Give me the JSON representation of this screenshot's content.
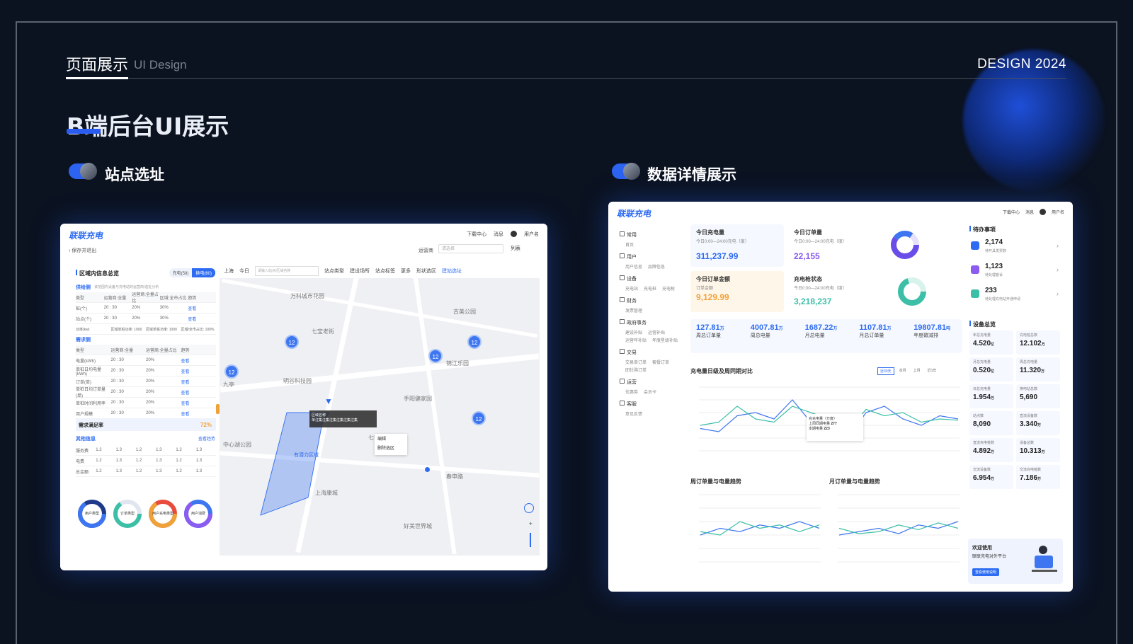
{
  "header": {
    "title": "页面展示",
    "subtitle": "UI Design",
    "right": "DESIGN 2024"
  },
  "page_title": "B端后台UI展示",
  "sections": {
    "left": "站点选址",
    "right": "数据详情展示"
  },
  "screen1": {
    "logo": "联联充电",
    "top_links": [
      "下载中心",
      "消息",
      "用户名"
    ],
    "back": "保存并退出",
    "operator_label": "运营商",
    "operator_placeholder": "请选择",
    "list_btn": "列表",
    "panel_title": "区域内信息总览",
    "tabs": [
      "充电(58)",
      "换电(60)"
    ],
    "supply_title": "供给侧",
    "supply_desc": "该范围内设备与充电站的运营商/选址分析",
    "supply_headers": [
      "类型",
      "运营商:全量",
      "运营商:全量占比",
      "区域:全市占比",
      "趋势"
    ],
    "supply_rows": [
      [
        "桩(个)",
        "20 : 30",
        "20%",
        "30%",
        "查看"
      ],
      [
        "站点(个)",
        "20 : 30",
        "20%",
        "30%",
        "查看"
      ],
      [
        "功率(kw)",
        "区域单桩功率: 1000",
        "区域单桩功率: 1000",
        "区域/全市占比: 100%",
        ""
      ]
    ],
    "demand_title": "需求侧",
    "demand_headers": [
      "类型",
      "运营商:全量",
      "运营商:全量占比",
      "趋势"
    ],
    "demand_rows": [
      [
        "电量(kWh)",
        "20 : 30",
        "20%",
        "查看"
      ],
      [
        "单桩日均电量(kWh)",
        "20 : 30",
        "20%",
        "查看"
      ],
      [
        "订单(单)",
        "20 : 30",
        "20%",
        "查看"
      ],
      [
        "单桩日均订单量(单)",
        "20 : 30",
        "20%",
        "查看"
      ],
      [
        "单桩时间利用率",
        "20 : 30",
        "20%",
        "查看"
      ],
      [
        "用户规模",
        "20 : 30",
        "20%",
        "查看"
      ]
    ],
    "satisfy_label": "需求满足率",
    "satisfy_value": "72%",
    "other_title": "其他信息",
    "other_link": "查看趋势",
    "other_rows": [
      [
        "服务费",
        "1.2",
        "1.3",
        "1.2",
        "1.3",
        "1.2",
        "1.3"
      ],
      [
        "电费",
        "1.2",
        "1.3",
        "1.2",
        "1.3",
        "1.2",
        "1.3"
      ],
      [
        "总金额",
        "1.2",
        "1.3",
        "1.2",
        "1.3",
        "1.2",
        "1.3"
      ]
    ],
    "donut_labels": [
      "用户类型",
      "订单类型",
      "用户充电类型",
      "用户消费"
    ],
    "filters": [
      "上海",
      "今日",
      "请输入站点/区域名称",
      "站点类型",
      "建设场所",
      "站点标签",
      "更多",
      "形状选区",
      "建站选址"
    ],
    "map_labels": [
      "万科城市花园",
      "七宝老街",
      "古美公园",
      "明谷科技园",
      "锦江乐园",
      "手阳健家园",
      "中心湖公园",
      "九亭",
      "七莘立",
      "春申路",
      "上海康城",
      "好美世界城"
    ],
    "cluster_count": "12",
    "popup_title": "区域名称",
    "popup_text": "单注集注集注集注集注集注集",
    "region_label": "有潜力区域",
    "context_menu": [
      "编辑",
      "删除选区"
    ]
  },
  "screen2": {
    "logo": "联联充电",
    "top_links": [
      "下载中心",
      "消息",
      "用户名"
    ],
    "sidebar": [
      {
        "label": "常用",
        "subs": [
          "首页"
        ]
      },
      {
        "label": "用户",
        "subs": [
          "用户信息",
          "品牌信息"
        ]
      },
      {
        "label": "设备",
        "subs": [
          "充电站",
          "充电桩",
          "充电枪"
        ]
      },
      {
        "label": "财务",
        "subs": [
          "发票管理"
        ]
      },
      {
        "label": "政府事务",
        "subs": [
          "建设补贴",
          "运营补贴",
          "运营年补贴",
          "年度星级补贴"
        ]
      },
      {
        "label": "交易",
        "subs": [
          "交易单订单",
          "套餐订单",
          "团社购订单"
        ]
      },
      {
        "label": "运营",
        "subs": [
          "优惠券",
          "会员卡"
        ]
      },
      {
        "label": "客服",
        "subs": [
          "意见反馈"
        ]
      }
    ],
    "kpi_top": [
      {
        "title": "今日充电量",
        "desc": "今日0:00—24:00充电（度）",
        "value": "311,237.99"
      },
      {
        "title": "今日订单量",
        "desc": "今日0:00—24:00充电（度）",
        "value": "22,155"
      },
      {
        "title": "今日订单金额",
        "desc": "订单金额",
        "value": "9,129.99"
      },
      {
        "title": "充电枪状态",
        "desc": "今日0:00—24:00充电（度）",
        "value": "3,218,237"
      }
    ],
    "kpi_row": [
      {
        "value": "127.81",
        "unit": "万",
        "label": "周总订单量"
      },
      {
        "value": "4007.81",
        "unit": "万",
        "label": "周总电量"
      },
      {
        "value": "1687.22",
        "unit": "万",
        "label": "月总电量"
      },
      {
        "value": "1107.81",
        "unit": "万",
        "label": "月总订单量"
      },
      {
        "value": "19807.81",
        "unit": "吨",
        "label": "年度碳减排"
      }
    ],
    "chart_titles": [
      "充电量日级及周同期对比",
      "周订单量与电量趋势",
      "月订单量与电量趋势"
    ],
    "chart_tabs": [
      "近30天",
      "本月",
      "上月",
      "近1年"
    ],
    "tooltip": {
      "title": "充充电量（万度）",
      "a_label": "上周同期电量",
      "a_value": "277",
      "b_label": "本期电量",
      "b_value": "223"
    },
    "todo_title": "待办事项",
    "todos": [
      {
        "value": "2,174",
        "label": "待开具发票数"
      },
      {
        "value": "1,123",
        "label": "待处理客诉"
      },
      {
        "value": "233",
        "label": "待处理充电站开通申请"
      }
    ],
    "device_title": "设备总览",
    "devices": [
      {
        "label": "年总充电量",
        "value": "4.520",
        "unit": "亿"
      },
      {
        "label": "充电桩总数",
        "value": "12.102",
        "unit": "万"
      },
      {
        "label": "月总充电量",
        "value": "0.520",
        "unit": "亿"
      },
      {
        "label": "周总充电量",
        "value": "11.320",
        "unit": "万"
      },
      {
        "label": "日总充电量",
        "value": "1.954",
        "unit": "万"
      },
      {
        "label": "换电站总数",
        "value": "5,690",
        "unit": ""
      },
      {
        "label": "站点数",
        "value": "8,090",
        "unit": ""
      },
      {
        "label": "直流设备数",
        "value": "3.340",
        "unit": "万"
      },
      {
        "label": "直流充电桩数",
        "value": "4.892",
        "unit": "万"
      },
      {
        "label": "设备总数",
        "value": "10.313",
        "unit": "万"
      },
      {
        "label": "交流设备数",
        "value": "6.954",
        "unit": "万"
      },
      {
        "label": "交流充电桩数",
        "value": "7.186",
        "unit": "万"
      }
    ],
    "welcome_title": "欢迎使用",
    "welcome_sub": "联联充电对外平台",
    "welcome_btn": "查看使用说明"
  },
  "colors": {
    "accent": "#2d6cf2",
    "bg": "#0b1220",
    "teal": "#3dbfa7",
    "orange": "#f0a23a"
  }
}
